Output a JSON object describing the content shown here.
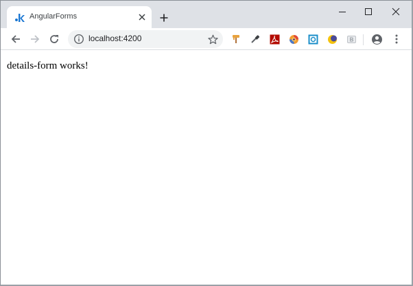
{
  "tab": {
    "title": "AngularForms",
    "favicon": "angular-k-favicon-icon"
  },
  "address_bar": {
    "url": "localhost:4200"
  },
  "extensions": [
    "paint-roller-extension-icon",
    "eyedropper-extension-icon",
    "acrobat-pdf-extension-icon",
    "color-wheel-extension-icon",
    "screenshot-capture-extension-icon",
    "moon-extension-icon",
    "b-badge-extension-icon"
  ],
  "page": {
    "body_text": "details-form works!"
  },
  "colors": {
    "tabstrip_bg": "#dee1e6",
    "omnibox_bg": "#f1f3f4",
    "favicon": "#1976d2"
  }
}
